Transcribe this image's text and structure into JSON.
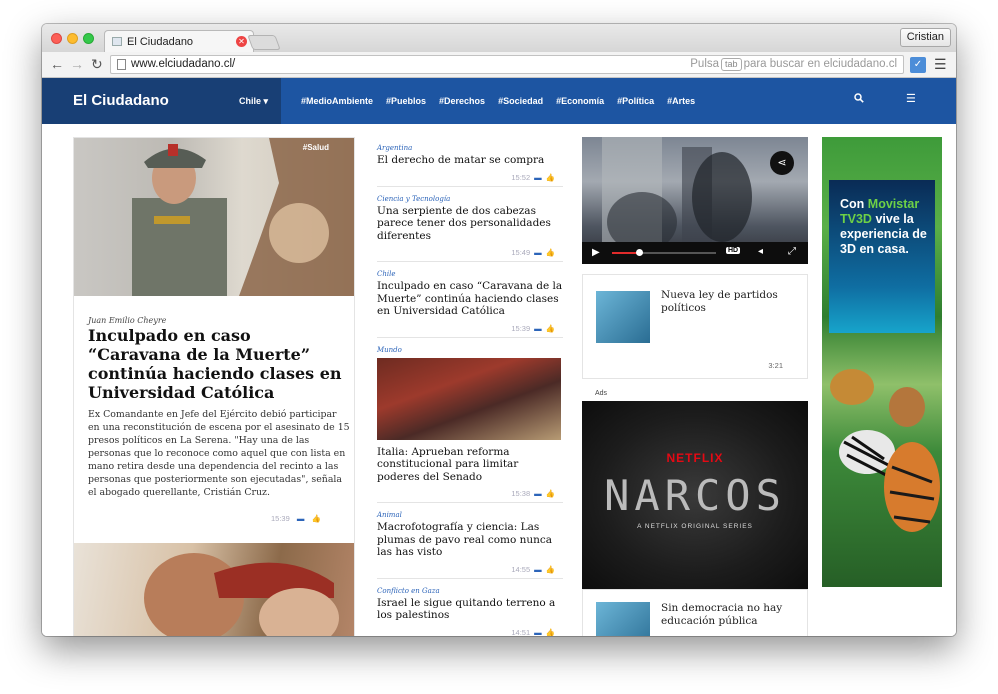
{
  "browser": {
    "tab_title": "El Ciudadano",
    "user": "Cristian",
    "url": "www.elciudadano.cl/",
    "hint_pre": "Pulsa",
    "hint_key": "tab",
    "hint_post": "para buscar en elciudadano.cl"
  },
  "site": {
    "brand": "El Ciudadano",
    "country": "Chile",
    "tags": [
      "#MedioAmbiente",
      "#Pueblos",
      "#Derechos",
      "#Sociedad",
      "#Economía",
      "#Política",
      "#Artes"
    ]
  },
  "feature": {
    "tag": "#Salud",
    "author": "Juan Emilio Cheyre",
    "title": "Inculpado en caso “Caravana de la Muerte” continúa haciendo clases en Universidad Católica",
    "summary": "Ex Comandante en Jefe del Ejército debió participar en una reconstitución de escena por el asesinato de 15 presos políticos en La Serena. \"Hay una de las personas que lo reconoce como aquel que con lista en mano retira desde una dependencia del recinto a las personas que posteriormente son ejecutadas\", señala el abogado querellante, Cristián Cruz.",
    "time": "15:39"
  },
  "news": [
    {
      "category": "Argentina",
      "title": "El derecho de matar se compra",
      "time": "15:52"
    },
    {
      "category": "Ciencia y Tecnología",
      "title": "Una serpiente de dos cabezas parece tener dos personalidades diferentes",
      "time": "15:49"
    },
    {
      "category": "Chile",
      "title": "Inculpado en caso “Caravana de la Muerte” continúa haciendo clases en Universidad Católica",
      "time": "15:39"
    },
    {
      "category": "Mundo",
      "title": "Italia: Aprueban reforma constitucional para limitar poderes del Senado",
      "time": "15:38"
    },
    {
      "category": "Animal",
      "title": "Macrofotografía y ciencia: Las plumas de pavo real como nunca las has visto",
      "time": "14:55"
    },
    {
      "category": "Conflicto en Gaza",
      "title": "Israel le sigue quitando terreno a los palestinos",
      "time": "14:51"
    }
  ],
  "video": {
    "quality": "HD"
  },
  "side_cards": [
    {
      "title": "Nueva ley de partidos políticos",
      "time": "3:21"
    },
    {
      "title": "Sin democracia no hay educación pública",
      "time": ""
    }
  ],
  "ads": {
    "label": "Ads",
    "netflix": "NETFLIX",
    "narcos": "NARCOS",
    "narcos_sub": "A NETFLIX ORIGINAL SERIES",
    "movistar_pre": "Con",
    "movistar_brand": "Movistar TV3D",
    "movistar_post": "vive la experiencia de 3D en casa."
  }
}
